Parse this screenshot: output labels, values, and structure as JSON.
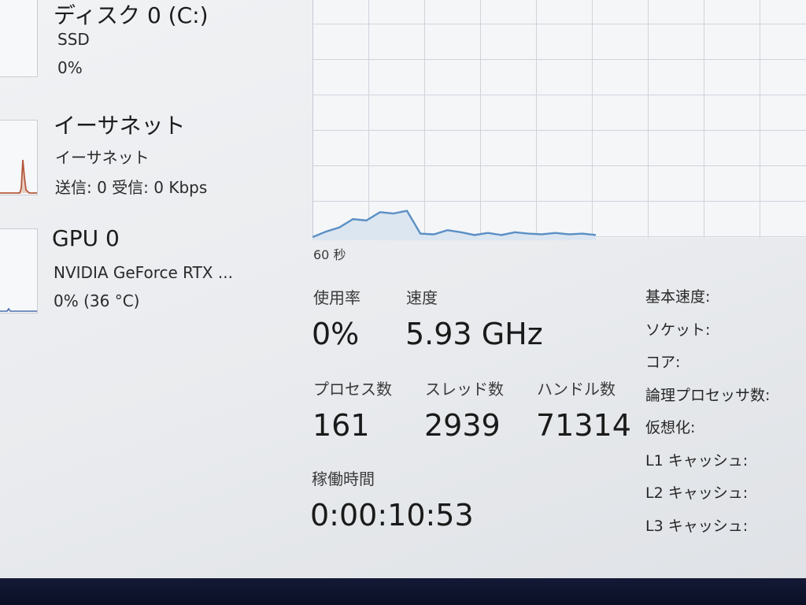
{
  "sidebar": {
    "disk": {
      "title": "ディスク 0 (C:)",
      "type": "SSD",
      "usage": "0%"
    },
    "ethernet": {
      "title": "イーサネット",
      "name": "イーサネット",
      "status": "送信: 0 受信: 0 Kbps"
    },
    "gpu": {
      "title": "GPU 0",
      "name": "NVIDIA GeForce RTX ...",
      "status": "0% (36 °C)"
    }
  },
  "graph": {
    "time_label": "60 秒",
    "line_color": "#5b8fc4",
    "fill_color": "#dbe6f1",
    "grid_color": "#cfd4db",
    "values": [
      0,
      8,
      14,
      26,
      24,
      36,
      34,
      38,
      5,
      4,
      10,
      7,
      3,
      6,
      3,
      7,
      5,
      4,
      6,
      4,
      5,
      3
    ]
  },
  "stats": {
    "utilization": {
      "label": "使用率",
      "value": "0%"
    },
    "speed": {
      "label": "速度",
      "value": "5.93 GHz"
    },
    "processes": {
      "label": "プロセス数",
      "value": "161"
    },
    "threads": {
      "label": "スレッド数",
      "value": "2939"
    },
    "handles": {
      "label": "ハンドル数",
      "value": "71314"
    },
    "uptime": {
      "label": "稼働時間",
      "value": "0:00:10:53"
    }
  },
  "properties": [
    {
      "label": "基本速度:",
      "value": ""
    },
    {
      "label": "ソケット:",
      "value": ""
    },
    {
      "label": "コア:",
      "value": ""
    },
    {
      "label": "論理プロセッサ数:",
      "value": ""
    },
    {
      "label": "仮想化:",
      "value": ""
    },
    {
      "label": "L1 キャッシュ:",
      "value": ""
    },
    {
      "label": "L2 キャッシュ:",
      "value": ""
    },
    {
      "label": "L3 キャッシュ:",
      "value": ""
    }
  ]
}
